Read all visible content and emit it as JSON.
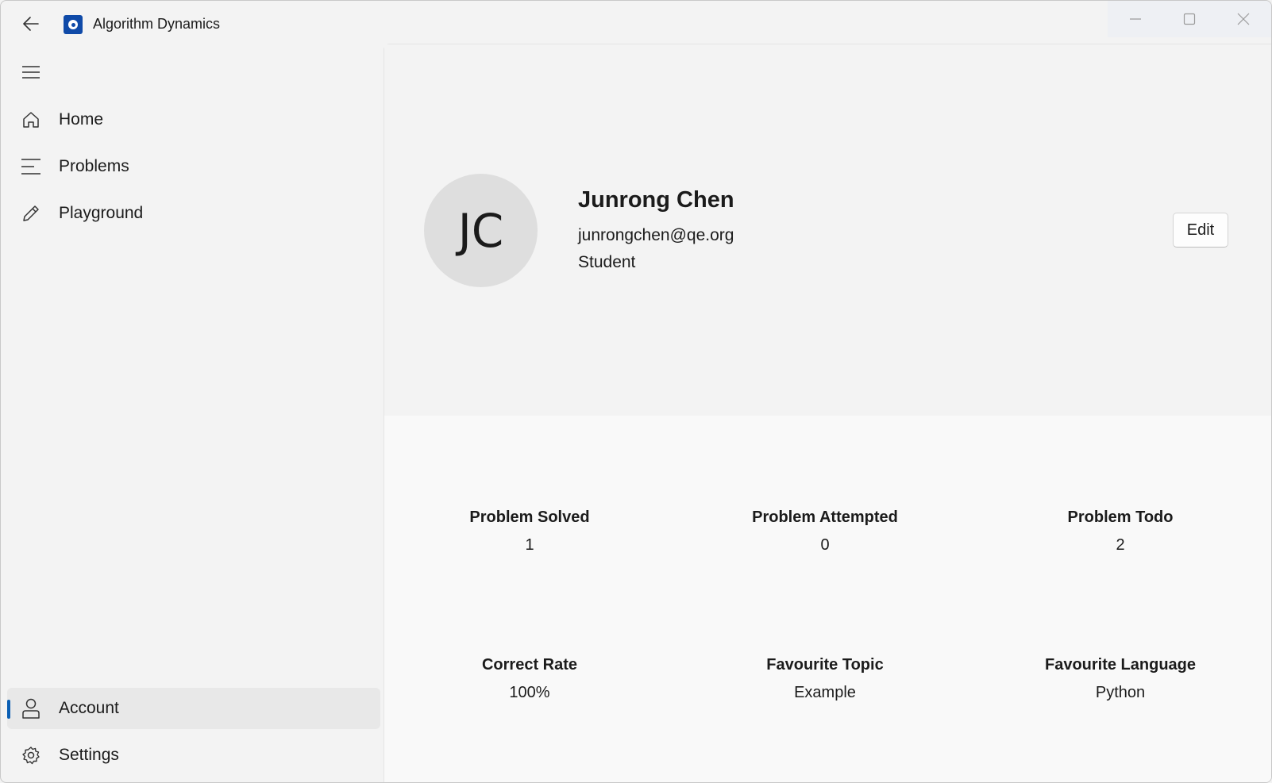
{
  "app": {
    "title": "Algorithm Dynamics"
  },
  "nav": {
    "items": [
      {
        "label": "Home",
        "icon": "home-icon"
      },
      {
        "label": "Problems",
        "icon": "list-icon"
      },
      {
        "label": "Playground",
        "icon": "pencil-icon"
      }
    ],
    "footer_items": [
      {
        "label": "Account",
        "icon": "person-icon",
        "selected": true
      },
      {
        "label": "Settings",
        "icon": "gear-icon"
      }
    ]
  },
  "profile": {
    "initials": "JC",
    "name": "Junrong Chen",
    "email": "junrongchen@qe.org",
    "role": "Student",
    "edit_label": "Edit"
  },
  "stats": [
    {
      "label": "Problem Solved",
      "value": "1"
    },
    {
      "label": "Problem Attempted",
      "value": "0"
    },
    {
      "label": "Problem Todo",
      "value": "2"
    },
    {
      "label": "Correct Rate",
      "value": "100%"
    },
    {
      "label": "Favourite Topic",
      "value": "Example"
    },
    {
      "label": "Favourite Language",
      "value": "Python"
    }
  ],
  "colors": {
    "accent": "#0a5fb4",
    "app_icon": "#0f4aa8",
    "avatar_bg": "#dedede"
  }
}
